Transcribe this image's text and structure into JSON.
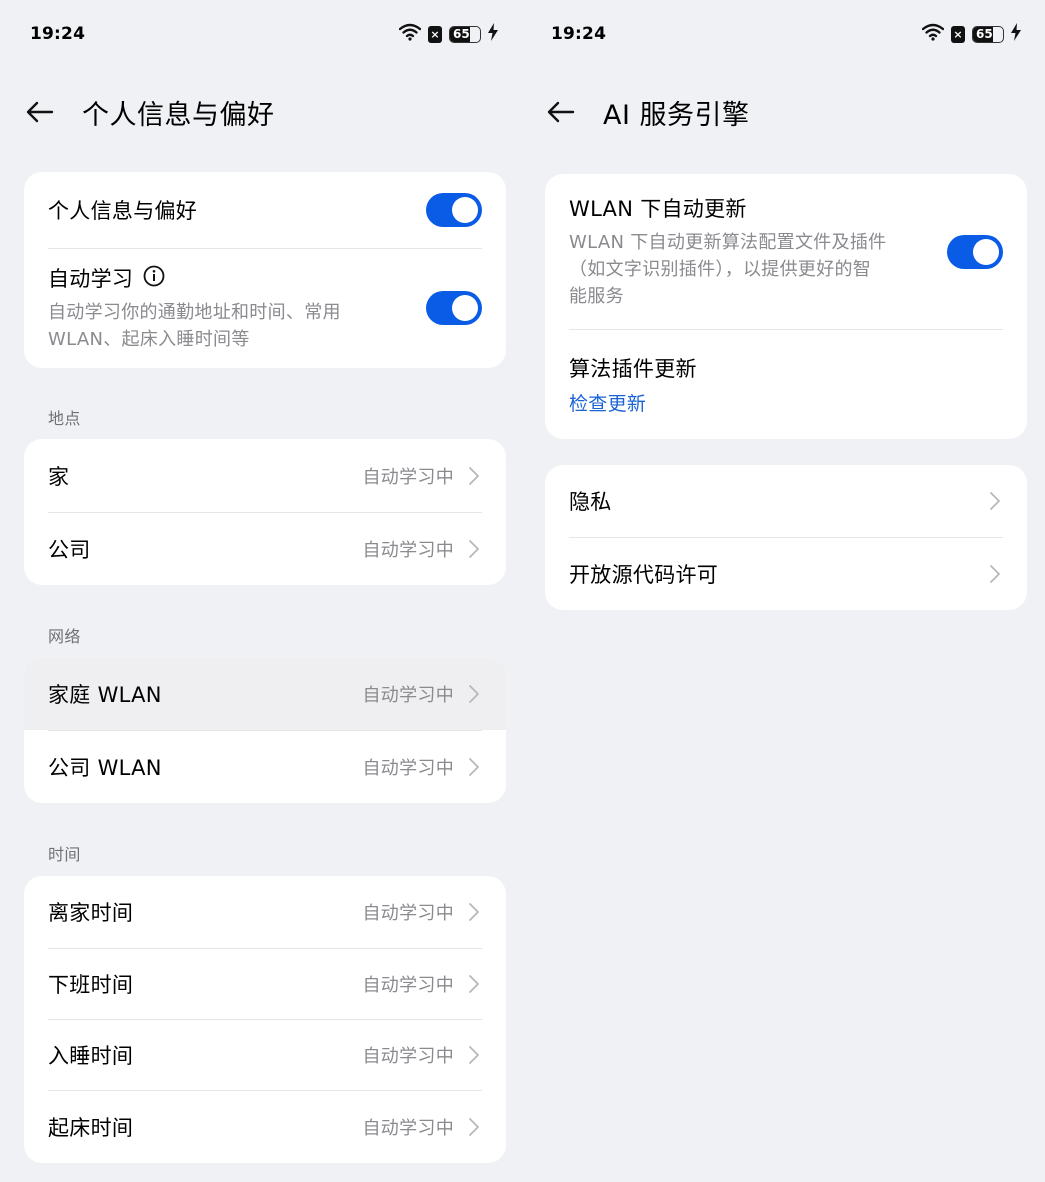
{
  "left": {
    "status": {
      "time": "19:24",
      "battery": "65"
    },
    "header": {
      "title": "个人信息与偏好"
    },
    "top_card": {
      "toggle_row": {
        "label": "个人信息与偏好",
        "enabled": true
      },
      "learn_row": {
        "label": "自动学习",
        "desc_line1": "自动学习你的通勤地址和时间、常用",
        "desc_line2": "WLAN、起床入睡时间等",
        "enabled": true
      }
    },
    "sections": [
      {
        "label": "地点",
        "items": [
          {
            "label": "家",
            "value": "自动学习中"
          },
          {
            "label": "公司",
            "value": "自动学习中"
          }
        ]
      },
      {
        "label": "网络",
        "items": [
          {
            "label": "家庭 WLAN",
            "value": "自动学习中"
          },
          {
            "label": "公司 WLAN",
            "value": "自动学习中"
          }
        ]
      },
      {
        "label": "时间",
        "items": [
          {
            "label": "离家时间",
            "value": "自动学习中"
          },
          {
            "label": "下班时间",
            "value": "自动学习中"
          },
          {
            "label": "入睡时间",
            "value": "自动学习中"
          },
          {
            "label": "起床时间",
            "value": "自动学习中"
          }
        ]
      }
    ]
  },
  "right": {
    "status": {
      "time": "19:24",
      "battery": "65"
    },
    "header": {
      "title": "AI 服务引擎"
    },
    "update_card": {
      "wlan_row": {
        "label": "WLAN 下自动更新",
        "desc_line1": "WLAN 下自动更新算法配置文件及插件",
        "desc_line2": "（如文字识别插件），以提供更好的智",
        "desc_line3": "能服务",
        "enabled": true
      },
      "plugin_row": {
        "label": "算法插件更新",
        "link": "检查更新"
      }
    },
    "links_card": {
      "items": [
        {
          "label": "隐私"
        },
        {
          "label": "开放源代码许可"
        }
      ]
    }
  },
  "colors": {
    "background": "#f0f1f5",
    "card": "#ffffff",
    "accent": "#0a5ce6",
    "link": "#1a63d6",
    "secondary_text": "#8a8a8f"
  },
  "icons": {
    "back": "arrow-left-icon",
    "chevron": "chevron-right-icon",
    "info": "info-icon",
    "wifi": "wifi-icon",
    "sim": "sim-x-icon",
    "battery": "battery-icon",
    "charging": "charging-bolt-icon"
  }
}
